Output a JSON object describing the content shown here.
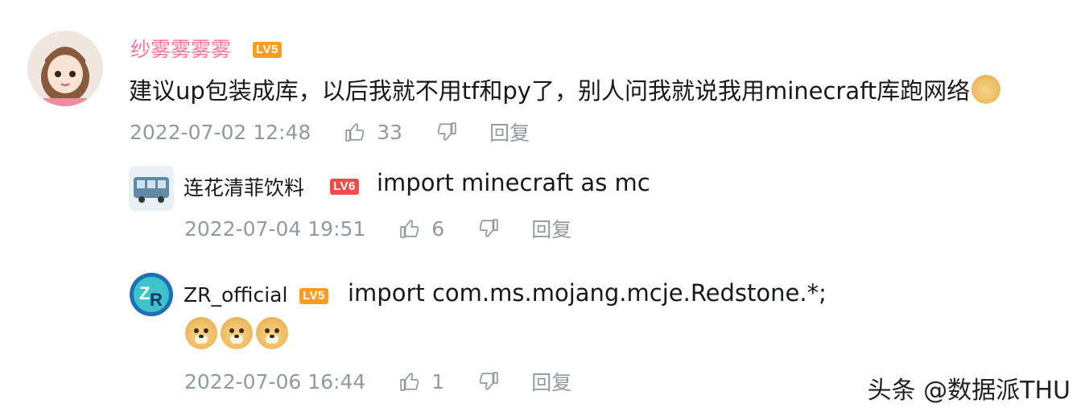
{
  "comments": [
    {
      "user": "纱雾雾雾雾",
      "level": "LV5",
      "text": "建议up包装成库，以后我就不用tf和py了，别人问我就说我用minecraft库跑网络",
      "time": "2022-07-02 12:48",
      "likes": "33",
      "reply": "回复"
    },
    {
      "user": "连花清菲饮料",
      "level": "LV6",
      "text": "import minecraft as mc",
      "time": "2022-07-04 19:51",
      "likes": "6",
      "reply": "回复"
    },
    {
      "user": "ZR_official",
      "level": "LV5",
      "text": "import com.ms.mojang.mcje.Redstone.*;",
      "time": "2022-07-06 16:44",
      "likes": "1",
      "reply": "回复",
      "emoji_count": 3
    }
  ],
  "watermark": "头条 @数据派THU",
  "colors": {
    "vip_name": "#fb7299",
    "level5": "#ff9d22",
    "level6": "#f04c49",
    "meta": "#9499a0"
  },
  "icons": {
    "like": "thumb-up-icon",
    "dislike": "thumb-down-icon",
    "emoji": "doge-emoji-icon"
  }
}
